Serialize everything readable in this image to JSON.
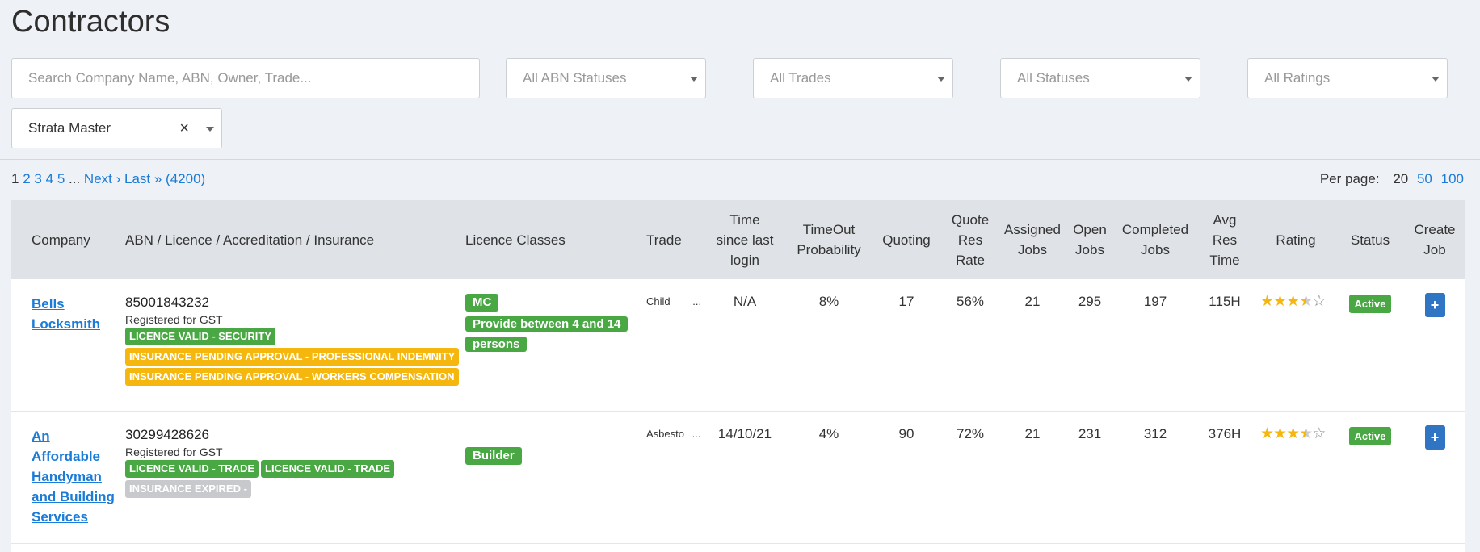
{
  "page": {
    "title": "Contractors"
  },
  "filters": {
    "search_placeholder": "Search Company Name, ABN, Owner, Trade...",
    "abn_status": "All ABN Statuses",
    "trades": "All Trades",
    "statuses": "All Statuses",
    "ratings": "All Ratings",
    "selected_filter": "Strata Master",
    "clear_symbol": "×"
  },
  "pagination": {
    "current": "1",
    "pages": [
      "2",
      "3",
      "4",
      "5"
    ],
    "ellipsis": "...",
    "next": "Next ›",
    "last": "Last »",
    "total": "(4200)"
  },
  "per_page": {
    "label": "Per page:",
    "current": "20",
    "options": [
      "50",
      "100"
    ]
  },
  "table": {
    "headers": {
      "company": "Company",
      "abn": "ABN / Licence / Accreditation / Insurance",
      "licence_classes": "Licence Classes",
      "trade": "Trade",
      "time_since_login": "Time since last login",
      "timeout_probability": "TimeOut Probability",
      "quoting": "Quoting",
      "quote_res_rate": "Quote Res Rate",
      "assigned_jobs": "Assigned Jobs",
      "open_jobs": "Open Jobs",
      "completed_jobs": "Completed Jobs",
      "avg_res_time": "Avg Res Time",
      "rating": "Rating",
      "status": "Status",
      "create_job": "Create Job"
    },
    "rows": [
      {
        "company": "Bells Locksmith",
        "abn": "85001843232",
        "gst": "Registered for GST",
        "badges": [
          {
            "text": "LICENCE VALID - SECURITY",
            "color": "#4aa844"
          },
          {
            "text": "INSURANCE PENDING APPROVAL - PROFESSIONAL INDEMNITY",
            "color": "#f5b70e"
          },
          {
            "text": "INSURANCE PENDING APPROVAL - WORKERS COMPENSATION",
            "color": "#f5b70e"
          }
        ],
        "licence_classes": [
          "MC",
          "Provide between 4 and 14 persons"
        ],
        "trade": "Child",
        "trade_more": "...",
        "time_since_login": "N/A",
        "timeout_probability": "8%",
        "quoting": "17",
        "quote_res_rate": "56%",
        "assigned_jobs": "21",
        "open_jobs": "295",
        "completed_jobs": "197",
        "avg_res_time": "115H",
        "rating": 3.5,
        "rating_max": 5,
        "status": "Active",
        "create_job_symbol": "+"
      },
      {
        "company": "An Affordable Handyman and Building Services",
        "abn": "30299428626",
        "gst": "Registered for GST",
        "badges": [
          {
            "text": "LICENCE VALID - TRADE",
            "color": "#4aa844"
          },
          {
            "text": "LICENCE VALID - TRADE",
            "color": "#4aa844"
          },
          {
            "text": "INSURANCE EXPIRED -",
            "color": "#c7c9cc"
          }
        ],
        "licence_classes": [
          "Builder"
        ],
        "trade": "Asbesto",
        "trade_more": "...",
        "time_since_login": "14/10/21",
        "timeout_probability": "4%",
        "quoting": "90",
        "quote_res_rate": "72%",
        "assigned_jobs": "21",
        "open_jobs": "231",
        "completed_jobs": "312",
        "avg_res_time": "376H",
        "rating": 3.5,
        "rating_max": 5,
        "status": "Active",
        "create_job_symbol": "+"
      }
    ]
  },
  "colors": {
    "link": "#1a7bd8",
    "active": "#4aa844",
    "pending": "#f5b70e",
    "expired": "#c7c9cc",
    "button": "#2f75c4"
  }
}
